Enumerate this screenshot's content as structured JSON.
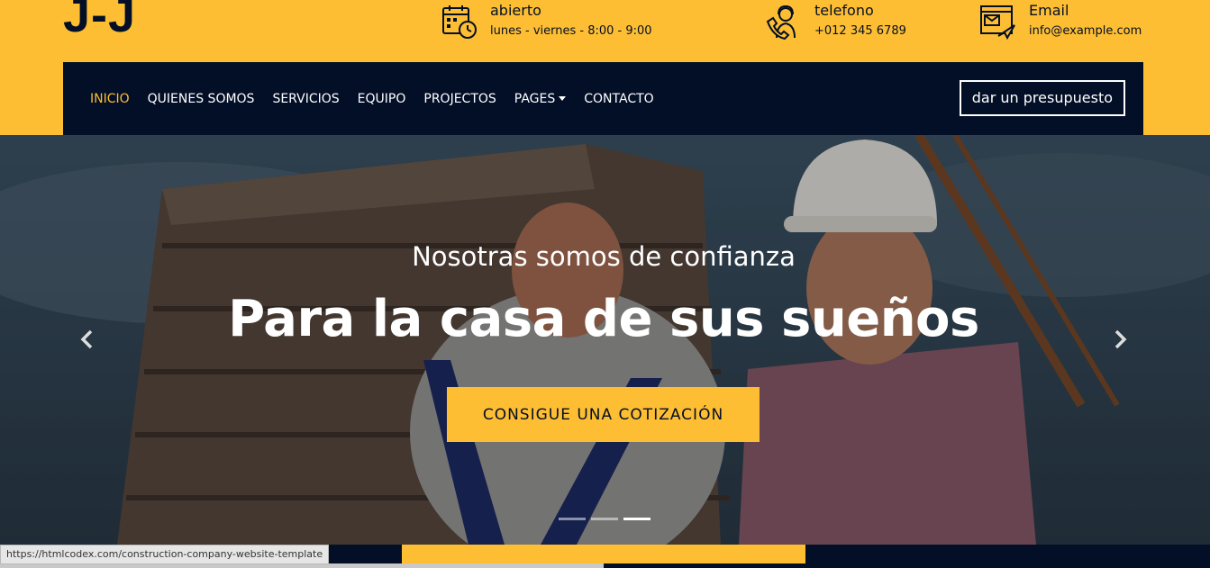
{
  "logo": "J-J",
  "info": [
    {
      "title": "abierto",
      "sub": "lunes - viernes - 8:00 - 9:00",
      "icon": "calendar-clock-icon"
    },
    {
      "title": "telefono",
      "sub": "+012 345 6789",
      "icon": "support-agent-icon"
    },
    {
      "title": "Email",
      "sub": "info@example.com",
      "icon": "email-window-icon"
    }
  ],
  "nav": {
    "items": [
      "INICIO",
      "QUIENES SOMOS",
      "SERVICIOS",
      "EQUIPO",
      "PROJECTOS",
      "PAGES",
      "CONTACTO"
    ],
    "active": "INICIO",
    "quote_button": "dar un presupuesto"
  },
  "hero": {
    "subtitle": "Nosotras somos de confianza",
    "title": "Para la casa de sus sueños",
    "button": "CONSIGUE UNA COTIZACIÓN",
    "slides": 3,
    "active_slide": 3
  },
  "status_url": "https://htmlcodex.com/construction-company-website-template",
  "colors": {
    "accent": "#fdbe33",
    "dark": "#030f27",
    "white": "#ffffff"
  }
}
